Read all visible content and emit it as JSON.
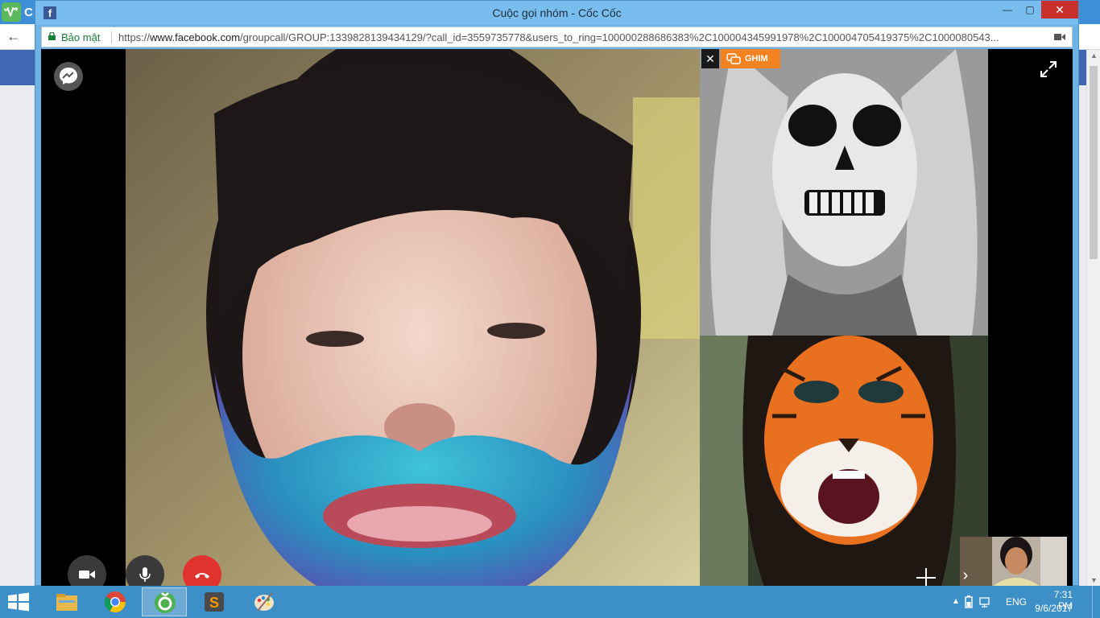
{
  "background_app": {
    "logo_text": "C",
    "icons": {
      "back": "arrow-left-icon",
      "logo": "coccoc-logo-icon"
    }
  },
  "popup": {
    "title": "Cuộc gọi nhóm - Cốc Cốc",
    "favicon": "f",
    "controls": {
      "minimize": "—",
      "maximize": "▢",
      "close": "✕"
    },
    "address": {
      "secure_label": "Bảo mật",
      "url_scheme": "https://",
      "url_host": "www.facebook.com",
      "url_path": "/groupcall/GROUP:1339828139434129/?call_id=3559735778&users_to_ring=100000288686383%2C100004345991978%2C100004705419375%2C1000080543..."
    }
  },
  "call": {
    "pin_label": "GHIM",
    "close_tile": "✕",
    "icons": {
      "messenger": "messenger-icon",
      "expand": "fullscreen-expand-icon",
      "video": "video-camera-icon",
      "mic": "microphone-icon",
      "end_call": "phone-hangup-icon",
      "add": "plus-icon",
      "next": "chevron-right-icon"
    },
    "colors": {
      "pin_bg": "#f58220",
      "end_call_bg": "#e0332d"
    }
  },
  "taskbar": {
    "apps": [
      {
        "name": "File Explorer",
        "icon": "folder-icon"
      },
      {
        "name": "Google Chrome",
        "icon": "chrome-icon"
      },
      {
        "name": "Cốc Cốc",
        "icon": "coccoc-icon",
        "active": true
      },
      {
        "name": "Sublime Text",
        "icon": "sublime-icon"
      },
      {
        "name": "Paint",
        "icon": "paint-palette-icon"
      }
    ],
    "tray": {
      "language": "ENG",
      "time": "7:31 PM",
      "date": "9/6/2017",
      "overflow": "▲"
    }
  }
}
